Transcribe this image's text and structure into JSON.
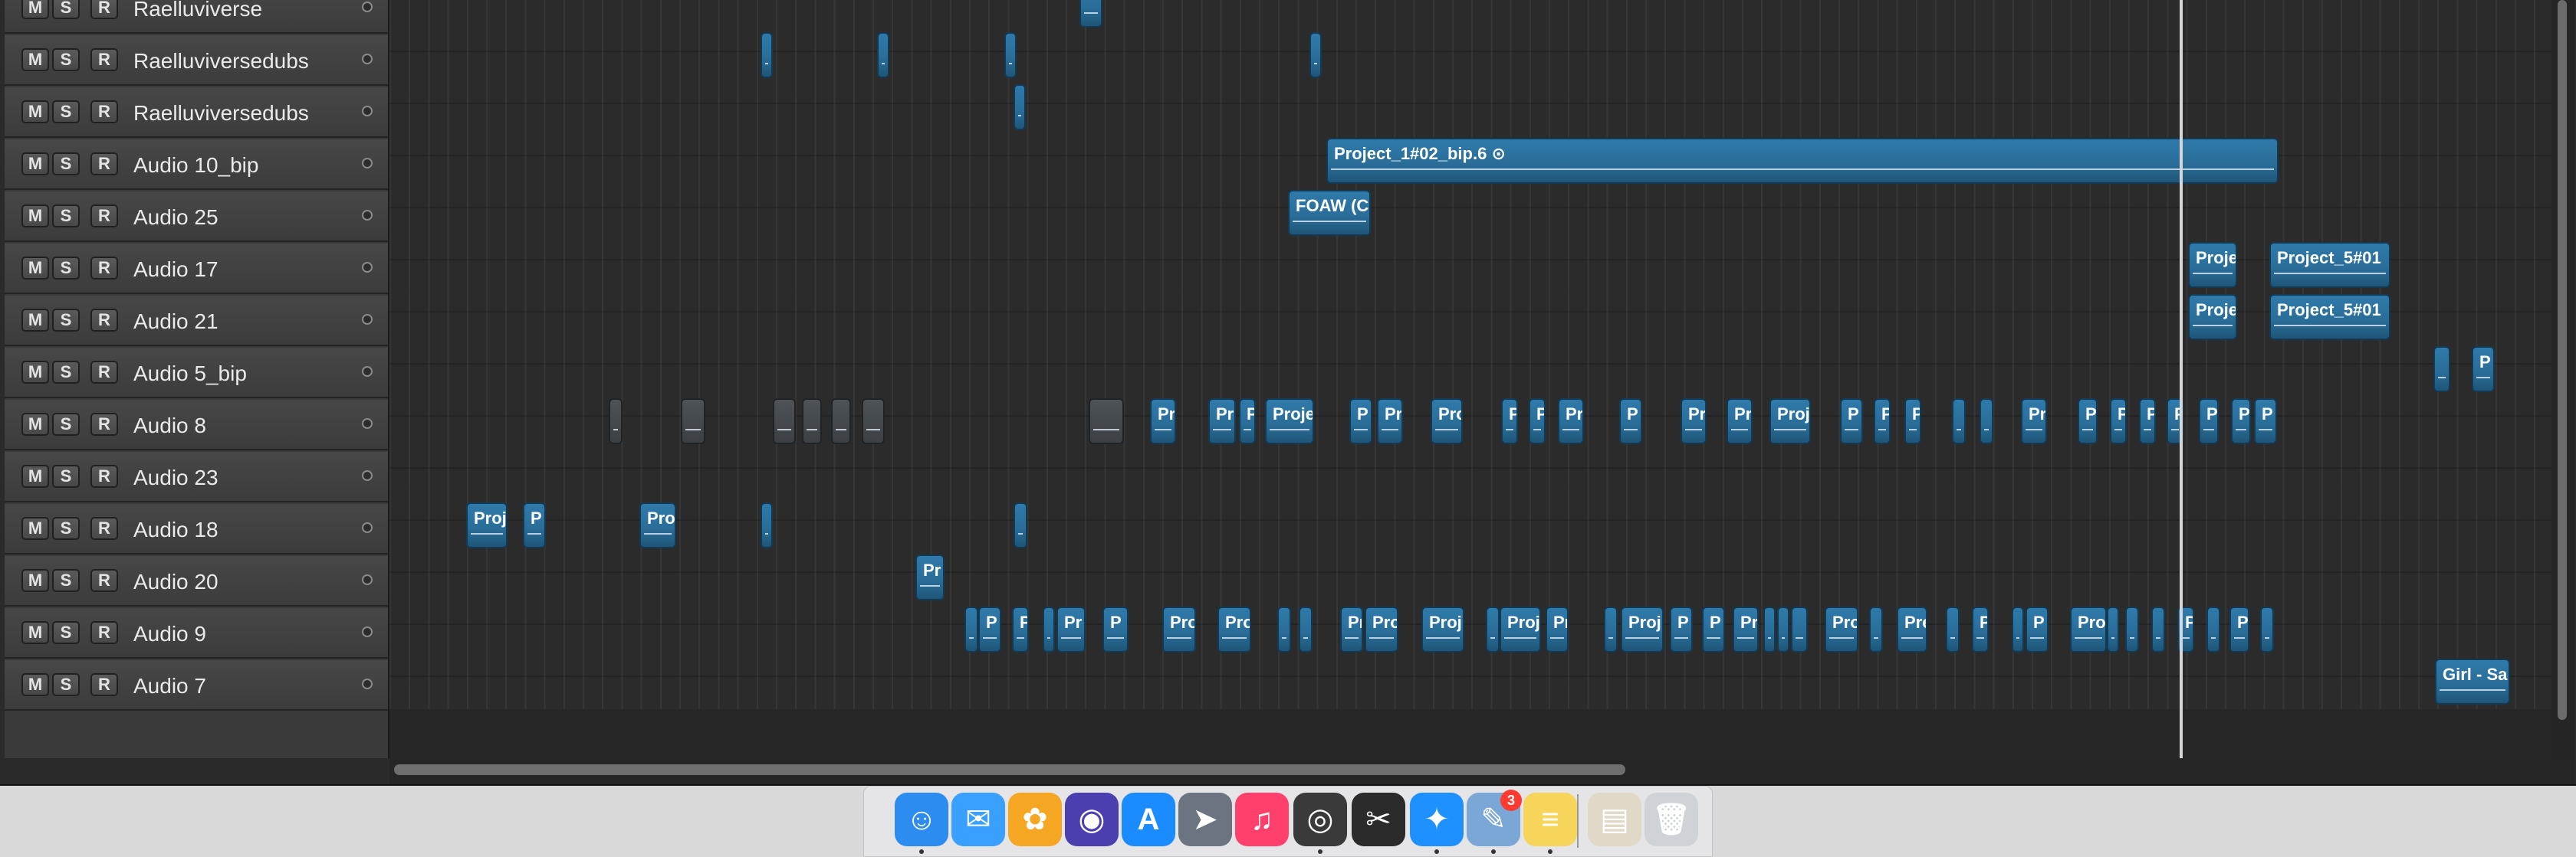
{
  "buttons": {
    "mute": "M",
    "solo": "S",
    "record": "R"
  },
  "tracks": [
    {
      "name": "Raelluviverse"
    },
    {
      "name": "Raelluviversedubs"
    },
    {
      "name": "Raelluviversedubs"
    },
    {
      "name": "Audio 10_bip"
    },
    {
      "name": "Audio 25"
    },
    {
      "name": "Audio 17"
    },
    {
      "name": "Audio 21"
    },
    {
      "name": "Audio 5_bip"
    },
    {
      "name": "Audio 8"
    },
    {
      "name": "Audio 23"
    },
    {
      "name": "Audio 18"
    },
    {
      "name": "Audio 20"
    },
    {
      "name": "Audio 9"
    },
    {
      "name": "Audio 7"
    }
  ],
  "regions": {
    "project_1_02_bip": "Project_1#02_bip.6 ⊙",
    "foaw": "FOAW (C",
    "proje": "Proje",
    "project_5_01": "Project_5#01",
    "pr": "Pr",
    "p": "P",
    "pro": "Pro",
    "proj": "Proj",
    "pre": "Pre",
    "girl": "Girl - Sa"
  },
  "dock": {
    "apps": [
      {
        "name": "Finder",
        "icon": "finder-icon",
        "color": "#2d8cf0",
        "glyph": "☺"
      },
      {
        "name": "Messages",
        "icon": "messages-icon",
        "color": "#3aa0ff",
        "glyph": "✉"
      },
      {
        "name": "Photos",
        "icon": "photos-icon",
        "color": "#f5a623",
        "glyph": "✿"
      },
      {
        "name": "Siri",
        "icon": "siri-icon",
        "color": "#4b3fb0",
        "glyph": "◉"
      },
      {
        "name": "App Store",
        "icon": "app-store-icon",
        "color": "#1a8cff",
        "glyph": "A"
      },
      {
        "name": "Launchpad",
        "icon": "launchpad-icon",
        "color": "#6b7480",
        "glyph": "➤"
      },
      {
        "name": "iTunes",
        "icon": "itunes-icon",
        "color": "#ff3f6c",
        "glyph": "♫"
      },
      {
        "name": "Logic Pro",
        "icon": "logic-pro-icon",
        "color": "#3a3a3a",
        "glyph": "◎"
      },
      {
        "name": "Final Cut Pro",
        "icon": "final-cut-pro-icon",
        "color": "#2b2b2b",
        "glyph": "✂"
      },
      {
        "name": "Safari",
        "icon": "safari-icon",
        "color": "#1e90ff",
        "glyph": "✦"
      },
      {
        "name": "Preview",
        "icon": "preview-icon",
        "color": "#7aa7d6",
        "glyph": "✎",
        "badge": "3"
      },
      {
        "name": "Notes",
        "icon": "notes-icon",
        "color": "#f7d45a",
        "glyph": "≡"
      },
      {
        "name": "Downloads",
        "icon": "downloads-stack-icon",
        "color": "#e0d9c8",
        "glyph": "▤"
      },
      {
        "name": "Trash",
        "icon": "trash-icon",
        "color": "#cfd3d8",
        "glyph": "🗑"
      }
    ]
  }
}
